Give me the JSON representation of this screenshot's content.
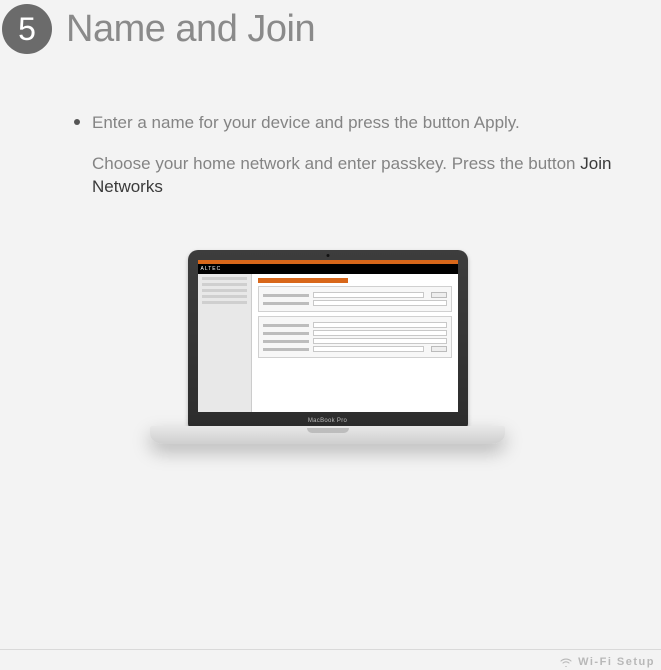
{
  "step": {
    "number": "5",
    "title": "Name and Join"
  },
  "instructions": {
    "line1": "Enter a name for your device and press the button Apply.",
    "line2a": "Choose your home network and enter passkey. Press the button ",
    "line2b_strong": "Join Networks"
  },
  "laptop": {
    "brand": "ALTEC",
    "model_label": "MacBook Pro"
  },
  "footer": {
    "label": "Wi-Fi Setup"
  }
}
